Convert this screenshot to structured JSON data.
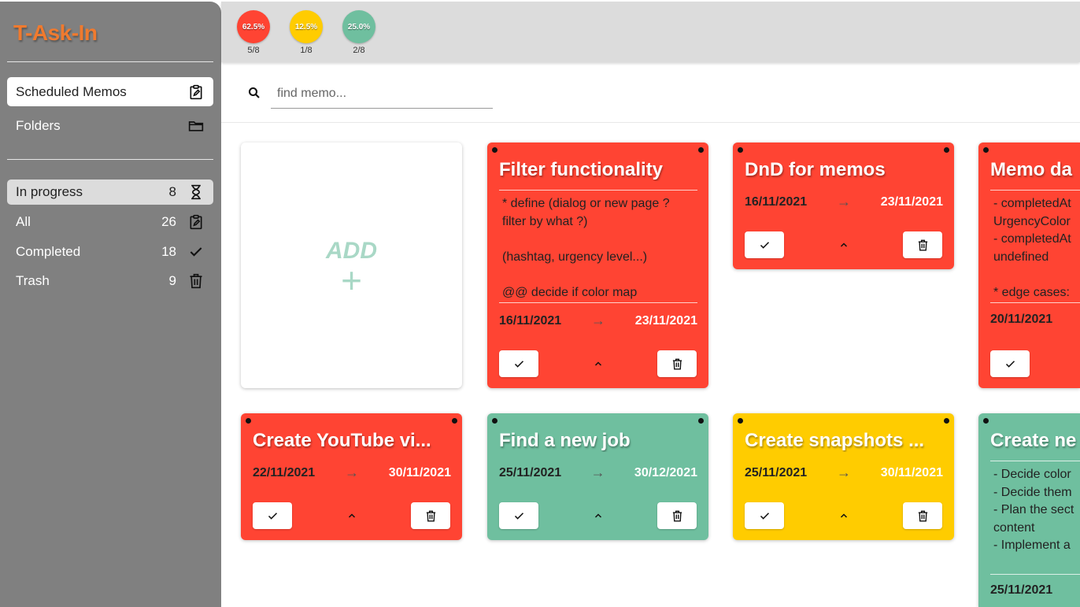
{
  "app": {
    "title": "T-Ask-In"
  },
  "sidebar": {
    "nav": [
      {
        "label": "Scheduled Memos",
        "icon": "clipboard-edit-icon"
      },
      {
        "label": "Folders",
        "icon": "folder-icon"
      }
    ],
    "filters": [
      {
        "label": "In progress",
        "count": "8",
        "icon": "hourglass-icon"
      },
      {
        "label": "All",
        "count": "26",
        "icon": "clipboard-edit-icon"
      },
      {
        "label": "Completed",
        "count": "18",
        "icon": "check-icon"
      },
      {
        "label": "Trash",
        "count": "9",
        "icon": "trash-icon"
      }
    ]
  },
  "stats": [
    {
      "percent": "62.5%",
      "fraction": "5/8",
      "color": "#ff4433"
    },
    {
      "percent": "12.5%",
      "fraction": "1/8",
      "color": "#ffcc00"
    },
    {
      "percent": "25.0%",
      "fraction": "2/8",
      "color": "#6fbf9f"
    }
  ],
  "search": {
    "placeholder": "find memo..."
  },
  "add_card": {
    "label": "ADD",
    "plus": "+"
  },
  "memos": [
    {
      "title": "Filter functionality",
      "body": "* define (dialog or new page ? filter by what ?)\n\n(hashtag, urgency level...)\n\n@@ decide if color map",
      "start": "16/11/2021",
      "end": "23/11/2021",
      "color": "red"
    },
    {
      "title": "DnD for memos",
      "body": "",
      "start": "16/11/2021",
      "end": "23/11/2021",
      "color": "red"
    },
    {
      "title": "Memo da",
      "body": "- completedAt\nUrgencyColor\n- completedAt\nundefined\n\n* edge cases:",
      "start": "20/11/2021",
      "end": "",
      "color": "red"
    },
    {
      "title": "Create YouTube vi...",
      "body": "",
      "start": "22/11/2021",
      "end": "30/11/2021",
      "color": "red"
    },
    {
      "title": "Find a new job",
      "body": "",
      "start": "25/11/2021",
      "end": "30/12/2021",
      "color": "green"
    },
    {
      "title": "Create snapshots ...",
      "body": "",
      "start": "25/11/2021",
      "end": "30/11/2021",
      "color": "yellow"
    },
    {
      "title": "Create ne",
      "body": "- Decide color\n- Decide them\n- Plan the sect\ncontent\n- Implement a",
      "start": "25/11/2021",
      "end": "",
      "color": "green"
    }
  ],
  "arrow": "→"
}
